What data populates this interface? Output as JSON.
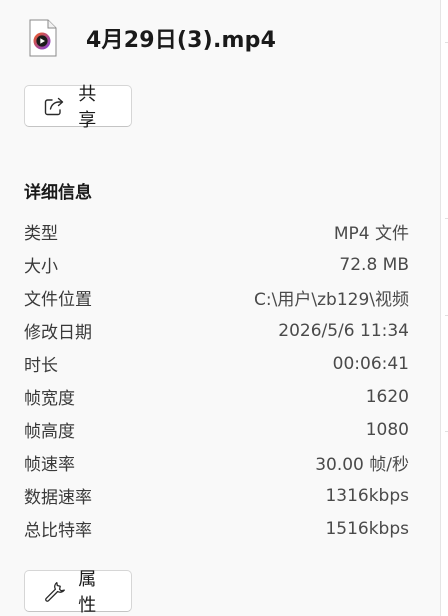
{
  "file": {
    "title": "4月29日(3).mp4",
    "icon": "video-file-icon"
  },
  "actions": {
    "share_label": "共享",
    "share_icon": "share-icon",
    "properties_label": "属性",
    "properties_icon": "wrench-icon"
  },
  "details": {
    "heading": "详细信息",
    "rows": [
      {
        "label": "类型",
        "value": "MP4 文件"
      },
      {
        "label": "大小",
        "value": "72.8 MB"
      },
      {
        "label": "文件位置",
        "value": "C:\\用户\\zb129\\视频"
      },
      {
        "label": "修改日期",
        "value": "2026/5/6 11:34"
      },
      {
        "label": "时长",
        "value": "00:06:41"
      },
      {
        "label": "帧宽度",
        "value": "1620"
      },
      {
        "label": "帧高度",
        "value": "1080"
      },
      {
        "label": "帧速率",
        "value": "30.00 帧/秒"
      },
      {
        "label": "数据速率",
        "value": "1316kbps"
      },
      {
        "label": "总比特率",
        "value": "1516kbps"
      }
    ]
  },
  "colors": {
    "pane_background": "#f9f9f9",
    "media_icon_orange": "#f25c1c",
    "media_icon_purple": "#7b3fe4"
  }
}
